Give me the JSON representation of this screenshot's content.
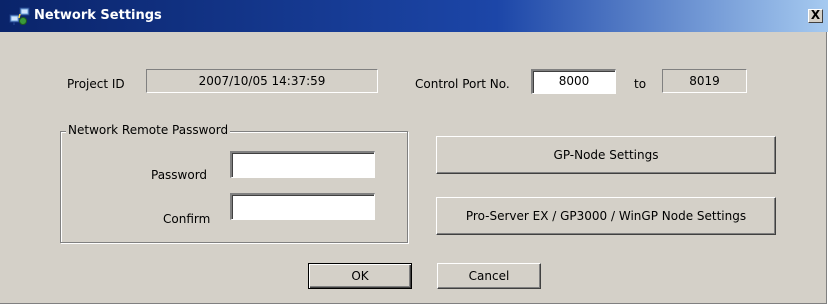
{
  "window": {
    "title": "Network Settings",
    "close_label": "X"
  },
  "project": {
    "label": "Project ID",
    "value": "2007/10/05 14:37:59"
  },
  "control_port": {
    "label": "Control Port No.",
    "start_value": "8000",
    "to_label": "to",
    "end_value": "8019"
  },
  "remote_password": {
    "group_label": "Network Remote Password",
    "password_label": "Password",
    "password_value": "",
    "confirm_label": "Confirm",
    "confirm_value": ""
  },
  "buttons": {
    "gp_node": "GP-Node Settings",
    "pro_server": "Pro-Server EX / GP3000 / WinGP Node Settings",
    "ok": "OK",
    "cancel": "Cancel"
  }
}
